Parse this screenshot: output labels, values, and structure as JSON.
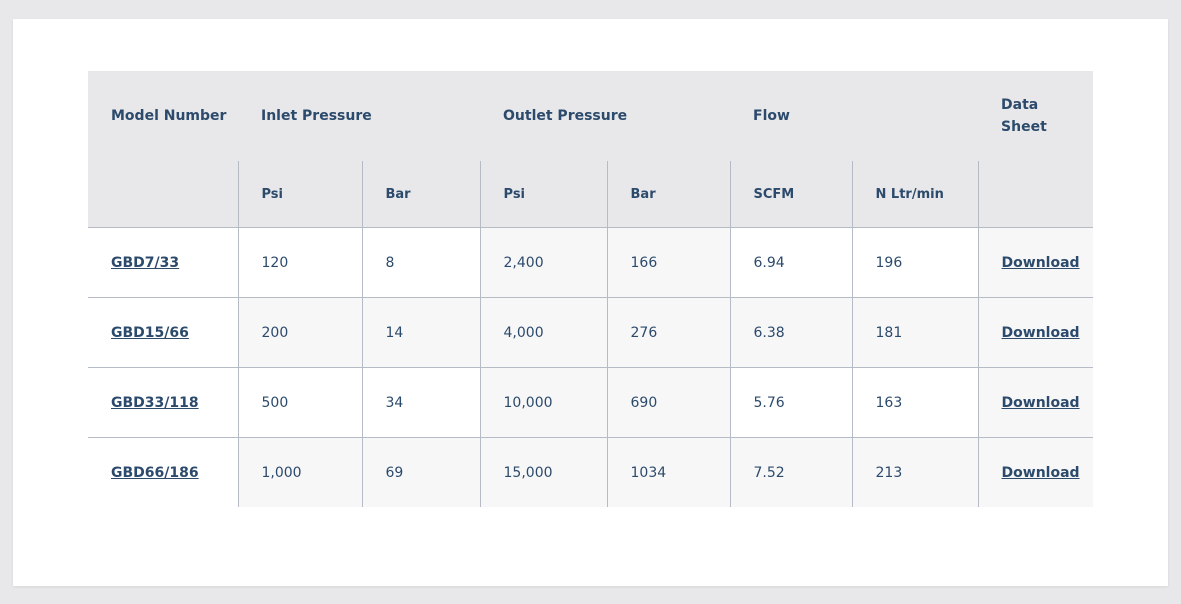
{
  "table": {
    "headers": {
      "model": "Model Number",
      "inlet": "Inlet Pressure",
      "outlet": "Outlet Pressure",
      "flow": "Flow",
      "datasheet": "Data Sheet"
    },
    "subheaders": [
      "Psi",
      "Bar",
      "Psi",
      "Bar",
      "SCFM",
      "N Ltr/min"
    ],
    "rows": [
      {
        "model": "GBD7/33",
        "inlet_psi": "120",
        "inlet_bar": "8",
        "outlet_psi": "2,400",
        "outlet_bar": "166",
        "scfm": "6.94",
        "nltr": "196",
        "download": "Download"
      },
      {
        "model": "GBD15/66",
        "inlet_psi": "200",
        "inlet_bar": "14",
        "outlet_psi": "4,000",
        "outlet_bar": "276",
        "scfm": "6.38",
        "nltr": "181",
        "download": "Download"
      },
      {
        "model": "GBD33/118",
        "inlet_psi": "500",
        "inlet_bar": "34",
        "outlet_psi": "10,000",
        "outlet_bar": "690",
        "scfm": "5.76",
        "nltr": "163",
        "download": "Download"
      },
      {
        "model": "GBD66/186",
        "inlet_psi": "1,000",
        "inlet_bar": "69",
        "outlet_psi": "15,000",
        "outlet_bar": "1034",
        "scfm": "7.52",
        "nltr": "213",
        "download": "Download"
      }
    ]
  },
  "colors": {
    "text": "#2c4a6b",
    "header_bg": "#e8e8ea",
    "row_shade": "#f7f7f8",
    "border": "#b6bcc6"
  }
}
